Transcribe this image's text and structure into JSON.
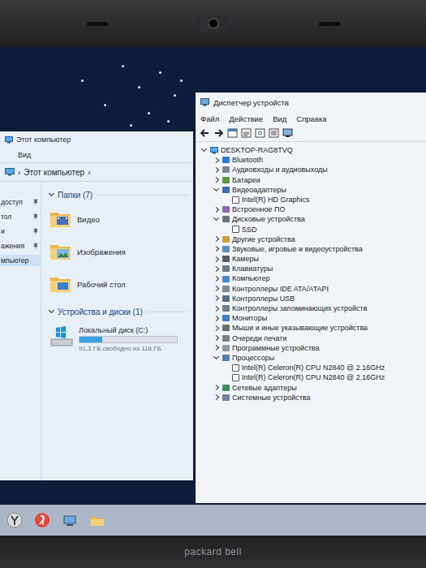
{
  "bezel": {
    "brand": "packard bell"
  },
  "explorer": {
    "title": "Этот компьютер",
    "ribbon_tabs": [
      {
        "label": "Вид"
      }
    ],
    "address": {
      "path": "Этот компьютер",
      "separator": "›"
    },
    "sidebar": {
      "items": [
        {
          "label": "доступ",
          "pinned": true,
          "selected": false
        },
        {
          "label": "тол",
          "pinned": true,
          "selected": false
        },
        {
          "label": "и",
          "pinned": true,
          "selected": false
        },
        {
          "label": "ажения",
          "pinned": true,
          "selected": false
        },
        {
          "label": "мпьютер",
          "pinned": false,
          "selected": true
        }
      ]
    },
    "folders": {
      "title": "Папки (7)",
      "expanded": true,
      "items": [
        {
          "label": "Видео"
        },
        {
          "label": "Изображения"
        },
        {
          "label": "Рабочий стол"
        }
      ]
    },
    "devices": {
      "title": "Устройства и диски (1)",
      "expanded": true,
      "items": [
        {
          "name": "Локальный диск (C:)",
          "free": "91,3 ГБ свободно из 118 ГБ",
          "level": 0.23
        }
      ]
    }
  },
  "device_manager": {
    "title": "Диспетчер устройств",
    "menu": [
      "Файл",
      "Действие",
      "Вид",
      "Справка"
    ],
    "root": {
      "label": "DESKTOP-RAG8TVQ",
      "expanded": true
    },
    "categories": [
      {
        "label": "Bluetooth",
        "expanded": false,
        "children": []
      },
      {
        "label": "Аудиовходы и аудиовыходы",
        "expanded": false,
        "children": []
      },
      {
        "label": "Батареи",
        "expanded": false,
        "children": []
      },
      {
        "label": "Видеоадаптеры",
        "expanded": true,
        "children": [
          "Intel(R) HD Graphics"
        ]
      },
      {
        "label": "Встроенное ПО",
        "expanded": false,
        "children": []
      },
      {
        "label": "Дисковые устройства",
        "expanded": true,
        "children": [
          "SSD"
        ]
      },
      {
        "label": "Другие устройства",
        "expanded": false,
        "children": []
      },
      {
        "label": "Звуковые, игровые и видеоустройства",
        "expanded": false,
        "children": []
      },
      {
        "label": "Камеры",
        "expanded": false,
        "children": []
      },
      {
        "label": "Клавиатуры",
        "expanded": false,
        "children": []
      },
      {
        "label": "Компьютер",
        "expanded": false,
        "children": []
      },
      {
        "label": "Контроллеры IDE ATA/ATAPI",
        "expanded": false,
        "children": []
      },
      {
        "label": "Контроллеры USB",
        "expanded": false,
        "children": []
      },
      {
        "label": "Контроллеры запоминающих устройств",
        "expanded": false,
        "children": []
      },
      {
        "label": "Мониторы",
        "expanded": false,
        "children": []
      },
      {
        "label": "Мыши и иные указывающие устройства",
        "expanded": false,
        "children": []
      },
      {
        "label": "Очереди печати",
        "expanded": false,
        "children": []
      },
      {
        "label": "Программные устройства",
        "expanded": false,
        "children": []
      },
      {
        "label": "Процессоры",
        "expanded": true,
        "children": [
          "Intel(R) Celeron(R) CPU  N2840  @ 2.16GHz",
          "Intel(R) Celeron(R) CPU  N2840  @ 2.16GHz"
        ]
      },
      {
        "label": "Сетевые адаптеры",
        "expanded": false,
        "children": []
      },
      {
        "label": "Системные устройства",
        "expanded": false,
        "children": []
      }
    ]
  }
}
